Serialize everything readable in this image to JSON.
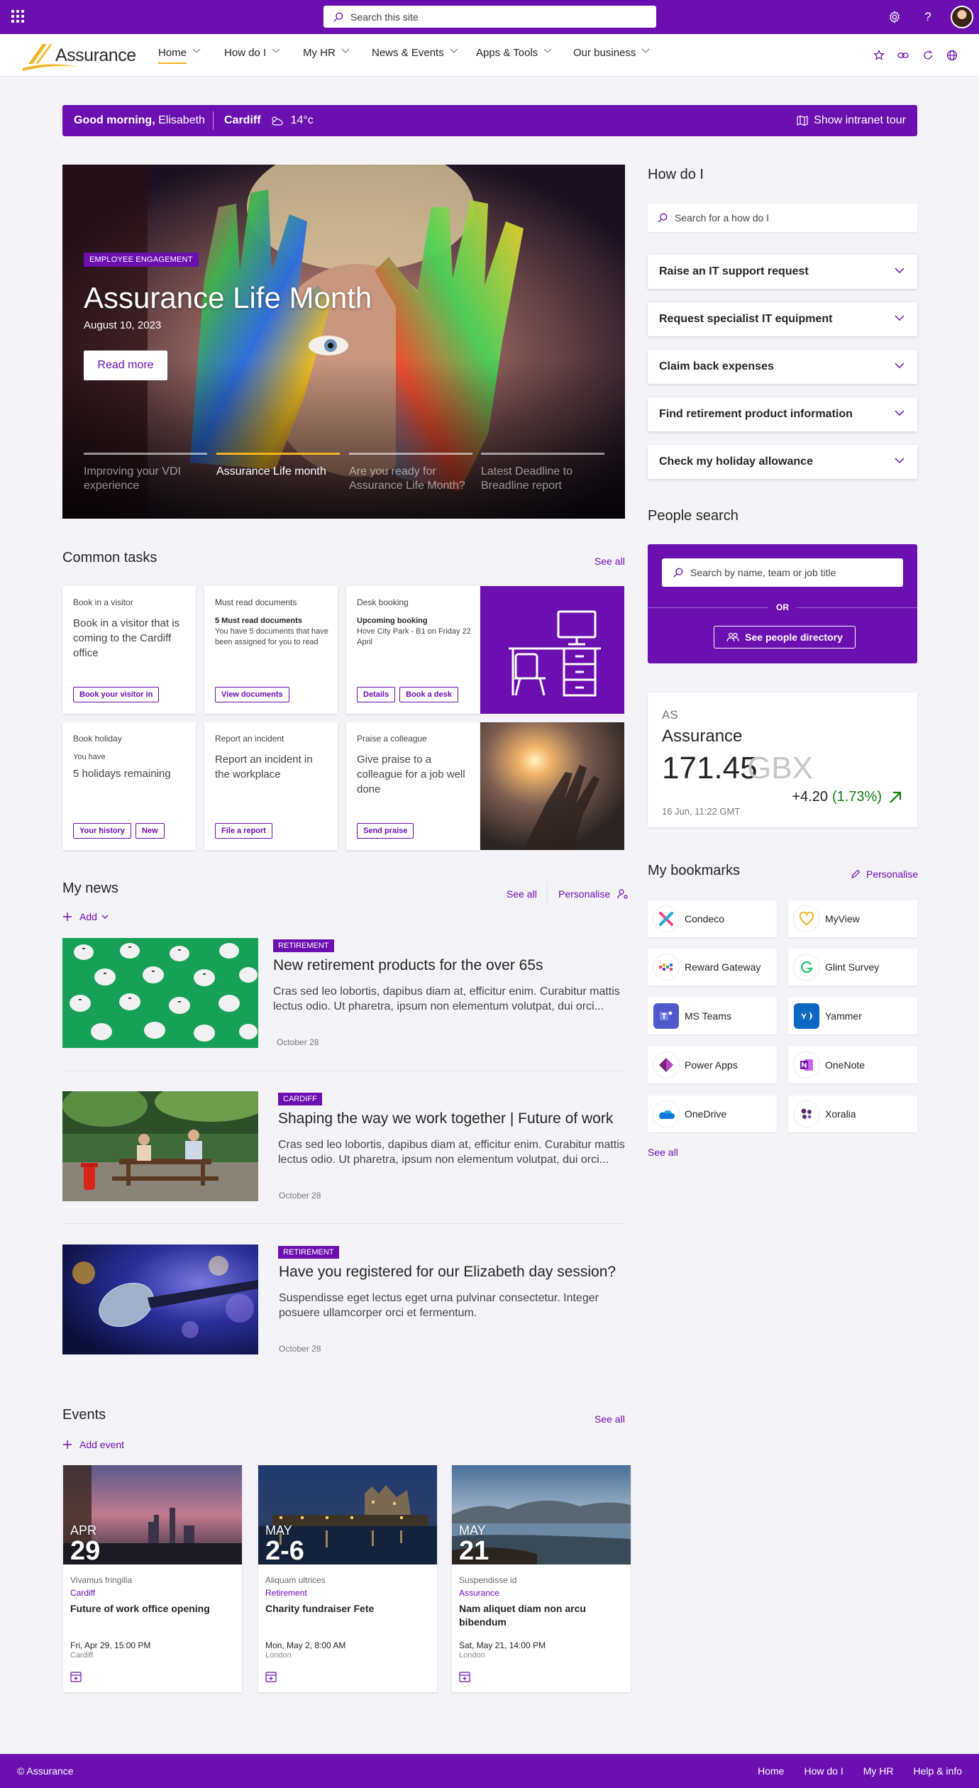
{
  "suite": {
    "search_placeholder": "Search this site"
  },
  "nav": {
    "logo": "Assurance",
    "items": [
      {
        "label": "Home"
      },
      {
        "label": "How do I"
      },
      {
        "label": "My HR"
      },
      {
        "label": "News & Events"
      },
      {
        "label": "Apps & Tools"
      },
      {
        "label": "Our business"
      }
    ]
  },
  "greeting": {
    "salutation": "Good morning,",
    "name": "Elisabeth",
    "city": "Cardiff",
    "temperature": "14°c",
    "tour": "Show intranet tour"
  },
  "hero": {
    "badge": "Employee engagement",
    "title": "Assurance Life Month",
    "date": "August 10, 2023",
    "read_more": "Read more",
    "tabs": [
      {
        "label": "Improving your VDI experience",
        "active": false
      },
      {
        "label": "Assurance Life month",
        "active": true
      },
      {
        "label": "Are you ready for Assurance Life Month?",
        "active": false
      },
      {
        "label": "Latest Deadline to Breadline report",
        "active": false
      }
    ]
  },
  "common_tasks": {
    "title": "Common tasks",
    "see_all": "See all",
    "visitor": {
      "caption": "Book in a visitor",
      "text": "Book in a visitor that is coming to the Cardiff office",
      "btn": "Book your visitor in"
    },
    "docs": {
      "caption": "Must read documents",
      "bold": "5 Must read documents",
      "text": "You have 5 documents that have been assigned for you to read",
      "btn": "View documents"
    },
    "desk": {
      "caption": "Desk booking",
      "bold": "Upcoming booking",
      "text": "Hove City Park - B1 on Friday 22 April",
      "btn1": "Details",
      "btn2": "Book a desk"
    },
    "holiday": {
      "caption": "Book holiday",
      "small": "You have",
      "text": "5 holidays remaining",
      "btn1": "Your history",
      "btn2": "New"
    },
    "incident": {
      "caption": "Report an incident",
      "text": "Report an incident in the workplace",
      "btn": "File a report"
    },
    "praise": {
      "caption": "Praise a colleague",
      "text": "Give praise to a colleague for a job well done",
      "btn": "Send praise"
    }
  },
  "how_do_i": {
    "title": "How do I",
    "search_placeholder": "Search for a how do I",
    "items": [
      "Raise an IT support request",
      "Request specialist IT equipment",
      "Claim back expenses",
      "Find retirement product information",
      "Check my holiday allowance"
    ]
  },
  "people": {
    "title": "People search",
    "placeholder": "Search by name, team or job title",
    "or": "OR",
    "directory": "See people directory"
  },
  "stock": {
    "symbol": "AS",
    "name": "Assurance",
    "price": "171.45",
    "currency": "GBX",
    "change": "+4.20",
    "percent": "(1.73%)",
    "time": "16 Jun, 11:22 GMT",
    "positive_color": "#107c10"
  },
  "bookmarks": {
    "title": "My bookmarks",
    "personalise": "Personalise",
    "see_all": "See all",
    "items": [
      "Condeco",
      "MyView",
      "Reward Gateway",
      "Glint Survey",
      "MS Teams",
      "Yammer",
      "Power Apps",
      "OneNote",
      "OneDrive",
      "Xoralia"
    ]
  },
  "news": {
    "title": "My news",
    "see_all": "See all",
    "personalise": "Personalise",
    "add": "Add",
    "items": [
      {
        "badge": "Retirement",
        "title": "New retirement products for the over 65s",
        "body": "Cras sed leo lobortis, dapibus diam at, efficitur enim. Curabitur mattis lectus odio. Ut pharetra, ipsum non elementum volutpat, dui orci...",
        "date": "October 28"
      },
      {
        "badge": "Cardiff",
        "title": "Shaping the way we work together | Future of work",
        "body": "Cras sed leo lobortis, dapibus diam at, efficitur enim. Curabitur mattis lectus odio. Ut pharetra, ipsum non elementum volutpat, dui orci...",
        "date": "October 28"
      },
      {
        "badge": "Retirement",
        "title": "Have you registered for our Elizabeth day session?",
        "body": "Suspendisse eget lectus eget urna pulvinar consectetur. Integer posuere ullamcorper orci et fermentum.",
        "date": "October 28"
      }
    ]
  },
  "events": {
    "title": "Events",
    "see_all": "See all",
    "add": "Add event",
    "items": [
      {
        "month": "APR",
        "day": "29",
        "category": "Vivamus fringilla",
        "site": "Cardiff",
        "title": "Future of work office opening",
        "time": "Fri, Apr 29, 15:00 PM",
        "location": "Cardiff"
      },
      {
        "month": "MAY",
        "day": "2-6",
        "category": "Aliquam ultrices",
        "site": "Retirement",
        "title": "Charity fundraiser Fete",
        "time": "Mon, May 2, 8:00 AM",
        "location": "London"
      },
      {
        "month": "MAY",
        "day": "21",
        "category": "Suspendisse id",
        "site": "Assurance",
        "title": "Nam aliquet diam non arcu bibendum",
        "time": "Sat, May 21, 14:00 PM",
        "location": "London"
      }
    ]
  },
  "footer": {
    "copyright": "© Assurance",
    "links": [
      "Home",
      "How do I",
      "My HR",
      "Help & info"
    ]
  },
  "colors": {
    "brand": "#6b0fb0",
    "accent": "#f0b323"
  }
}
